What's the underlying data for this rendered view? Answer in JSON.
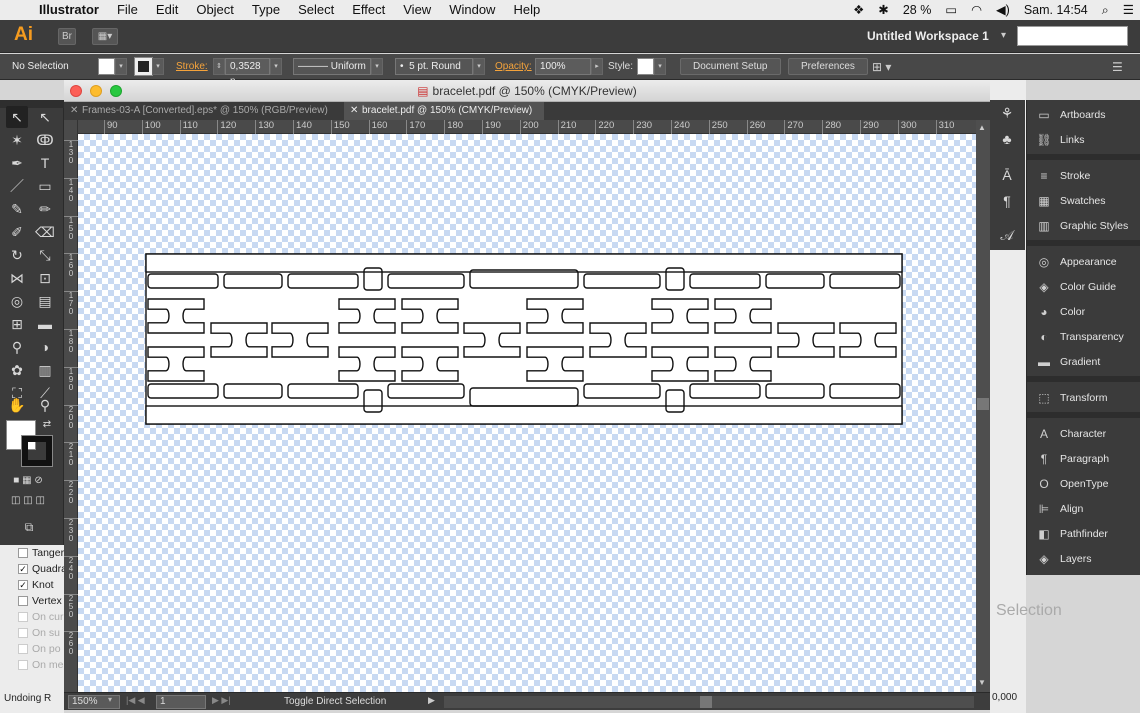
{
  "menubar": {
    "app": "Illustrator",
    "items": [
      "File",
      "Edit",
      "Object",
      "Type",
      "Select",
      "Effect",
      "View",
      "Window",
      "Help"
    ],
    "battery": "28 %",
    "clock": "Sam. 14:54"
  },
  "appbar": {
    "logo": "Ai",
    "workspace": "Untitled Workspace 1",
    "bridge_label": "Br"
  },
  "controlbar": {
    "selection": "No Selection",
    "stroke_label": "Stroke:",
    "stroke_value": "0,3528 n",
    "profile": "Uniform",
    "brush": "5 pt. Round",
    "opacity_label": "Opacity:",
    "opacity_value": "100%",
    "style_label": "Style:",
    "doc_setup": "Document Setup",
    "preferences": "Preferences"
  },
  "document": {
    "title": "bracelet.pdf @ 150% (CMYK/Preview)",
    "tabs": [
      {
        "label": "Frames-03-A [Converted].eps* @ 150% (RGB/Preview)",
        "active": false
      },
      {
        "label": "bracelet.pdf @ 150% (CMYK/Preview)",
        "active": true
      }
    ],
    "ruler_h": [
      "90",
      "100",
      "110",
      "120",
      "130",
      "140",
      "150",
      "160",
      "170",
      "180",
      "190",
      "200",
      "210",
      "220",
      "230",
      "240",
      "250",
      "260",
      "270",
      "280",
      "290",
      "300",
      "310"
    ],
    "ruler_v": [
      "130",
      "140",
      "150",
      "160",
      "170",
      "180",
      "190",
      "200",
      "210",
      "220",
      "230",
      "240",
      "250",
      "260"
    ],
    "zoom": "150%",
    "page": "1",
    "status": "Toggle Direct Selection"
  },
  "behind_panel": {
    "items": [
      {
        "label": "Tanger",
        "checked": false,
        "disabled": false
      },
      {
        "label": "Quadra",
        "checked": true,
        "disabled": false
      },
      {
        "label": "Knot",
        "checked": true,
        "disabled": false
      },
      {
        "label": "Vertex",
        "checked": false,
        "disabled": false
      },
      {
        "label": "On cur",
        "checked": false,
        "disabled": true
      },
      {
        "label": "On su",
        "checked": false,
        "disabled": true
      },
      {
        "label": "On po",
        "checked": false,
        "disabled": true
      },
      {
        "label": "On me",
        "checked": false,
        "disabled": true
      }
    ],
    "bottom_text": "Undoing R",
    "selection_text": "Selection",
    "number_text": "0,000"
  },
  "panels": [
    {
      "label": "Artboards",
      "icon": "artboards-icon",
      "glyph": "▭"
    },
    {
      "label": "Links",
      "icon": "links-icon",
      "glyph": "⛓"
    },
    {
      "sep": true
    },
    {
      "label": "Stroke",
      "icon": "stroke-icon",
      "glyph": "≡"
    },
    {
      "label": "Swatches",
      "icon": "swatches-icon",
      "glyph": "▦"
    },
    {
      "label": "Graphic Styles",
      "icon": "graphic-styles-icon",
      "glyph": "▥"
    },
    {
      "sep": true
    },
    {
      "label": "Appearance",
      "icon": "appearance-icon",
      "glyph": "◎"
    },
    {
      "label": "Color Guide",
      "icon": "color-guide-icon",
      "glyph": "◈"
    },
    {
      "label": "Color",
      "icon": "color-icon",
      "glyph": "◕"
    },
    {
      "label": "Transparency",
      "icon": "transparency-icon",
      "glyph": "◐"
    },
    {
      "label": "Gradient",
      "icon": "gradient-icon",
      "glyph": "▬"
    },
    {
      "sep": true
    },
    {
      "label": "Transform",
      "icon": "transform-icon",
      "glyph": "⬚"
    },
    {
      "sep": true
    },
    {
      "label": "Character",
      "icon": "character-icon",
      "glyph": "A"
    },
    {
      "label": "Paragraph",
      "icon": "paragraph-icon",
      "glyph": "¶"
    },
    {
      "label": "OpenType",
      "icon": "opentype-icon",
      "glyph": "O"
    },
    {
      "label": "Align",
      "icon": "align-icon",
      "glyph": "⊫"
    },
    {
      "label": "Pathfinder",
      "icon": "pathfinder-icon",
      "glyph": "◧"
    },
    {
      "label": "Layers",
      "icon": "layers-icon",
      "glyph": "◈"
    }
  ],
  "colors": {
    "accent_orange": "#f5a33b",
    "canvas_check": "#c8d9f2",
    "ui_dark": "#3b3b3b"
  }
}
